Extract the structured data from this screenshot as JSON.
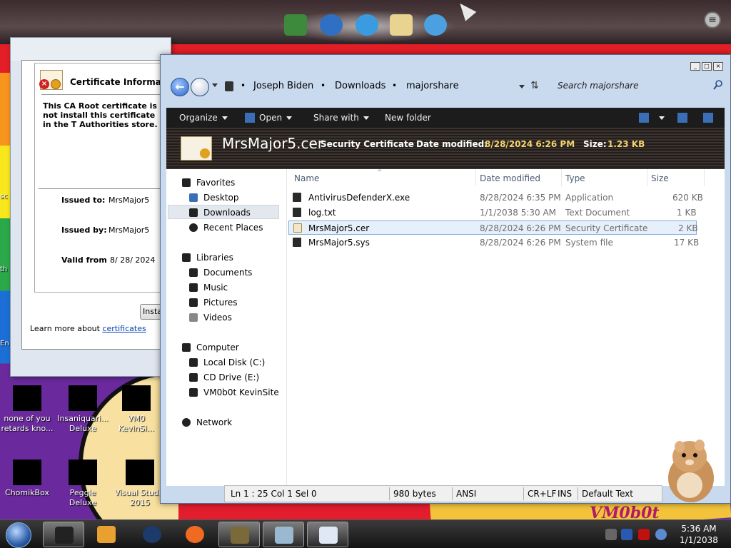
{
  "desktop": {
    "icons": [
      {
        "label": "none of you retards kno..."
      },
      {
        "label": "Insaniquari... Deluxe"
      },
      {
        "label": "VM0 KevinSi..."
      },
      {
        "label": "ChomikBox"
      },
      {
        "label": "Peggle Deluxe"
      },
      {
        "label": "Visual Studio 2015"
      }
    ],
    "edge_texts": [
      "sc",
      "th",
      "En"
    ],
    "watermark": "VM0b0t"
  },
  "cert_dialog": {
    "heading": "Certificate Information",
    "warning": "This CA Root certificate is not install this certificate in the T Authorities store.",
    "issued_to_label": "Issued to:",
    "issued_to_value": "MrsMajor5",
    "issued_by_label": "Issued by:",
    "issued_by_value": "MrsMajor5",
    "valid_from_label": "Valid from",
    "valid_from_value": "8/ 28/ 2024",
    "install_button": "Insta",
    "learn_more_prefix": "Learn more about",
    "learn_more_link": "certificates"
  },
  "explorer": {
    "breadcrumb": [
      "Joseph Biden",
      "Downloads",
      "majorshare"
    ],
    "search_placeholder": "Search majorshare",
    "toolbar": {
      "organize": "Organize",
      "open": "Open",
      "share_with": "Share with",
      "new_folder": "New folder"
    },
    "details": {
      "name": "MrsMajor5.cer",
      "type": "Security Certificate",
      "modified_label": "Date modified:",
      "modified_value": "8/28/2024 6:26 PM",
      "size_label": "Size:",
      "size_value": "1.23 KB"
    },
    "nav": {
      "favorites": "Favorites",
      "desktop": "Desktop",
      "downloads": "Downloads",
      "recent": "Recent Places",
      "libraries": "Libraries",
      "documents": "Documents",
      "music": "Music",
      "pictures": "Pictures",
      "videos": "Videos",
      "computer": "Computer",
      "local_disk": "Local Disk (C:)",
      "cd_drive": "CD Drive (E:)",
      "vm_site": "VM0b0t KevinSite",
      "network": "Network"
    },
    "columns": {
      "name": "Name",
      "date": "Date modified",
      "type": "Type",
      "size": "Size"
    },
    "files": [
      {
        "name": "AntivirusDefenderX.exe",
        "date": "8/28/2024 6:35 PM",
        "type": "Application",
        "size": "620 KB"
      },
      {
        "name": "log.txt",
        "date": "1/1/2038 5:30 AM",
        "type": "Text Document",
        "size": "1 KB"
      },
      {
        "name": "MrsMajor5.cer",
        "date": "8/28/2024 6:26 PM",
        "type": "Security Certificate",
        "size": "2 KB"
      },
      {
        "name": "MrsMajor5.sys",
        "date": "8/28/2024 6:26 PM",
        "type": "System file",
        "size": "17 KB"
      }
    ]
  },
  "notepad_status": {
    "position": "Ln 1 : 25   Col 1   Sel 0",
    "bytes": "980 bytes",
    "encoding": "ANSI",
    "eol": "CR+LF",
    "mode": "INS",
    "style": "Default Text"
  },
  "clock": {
    "time": "5:36 AM",
    "date": "1/1/2038"
  },
  "colors": {
    "accent": "#2d67c5",
    "dark_bar": "#1c1c1c",
    "selection": "#e6f0fb"
  }
}
